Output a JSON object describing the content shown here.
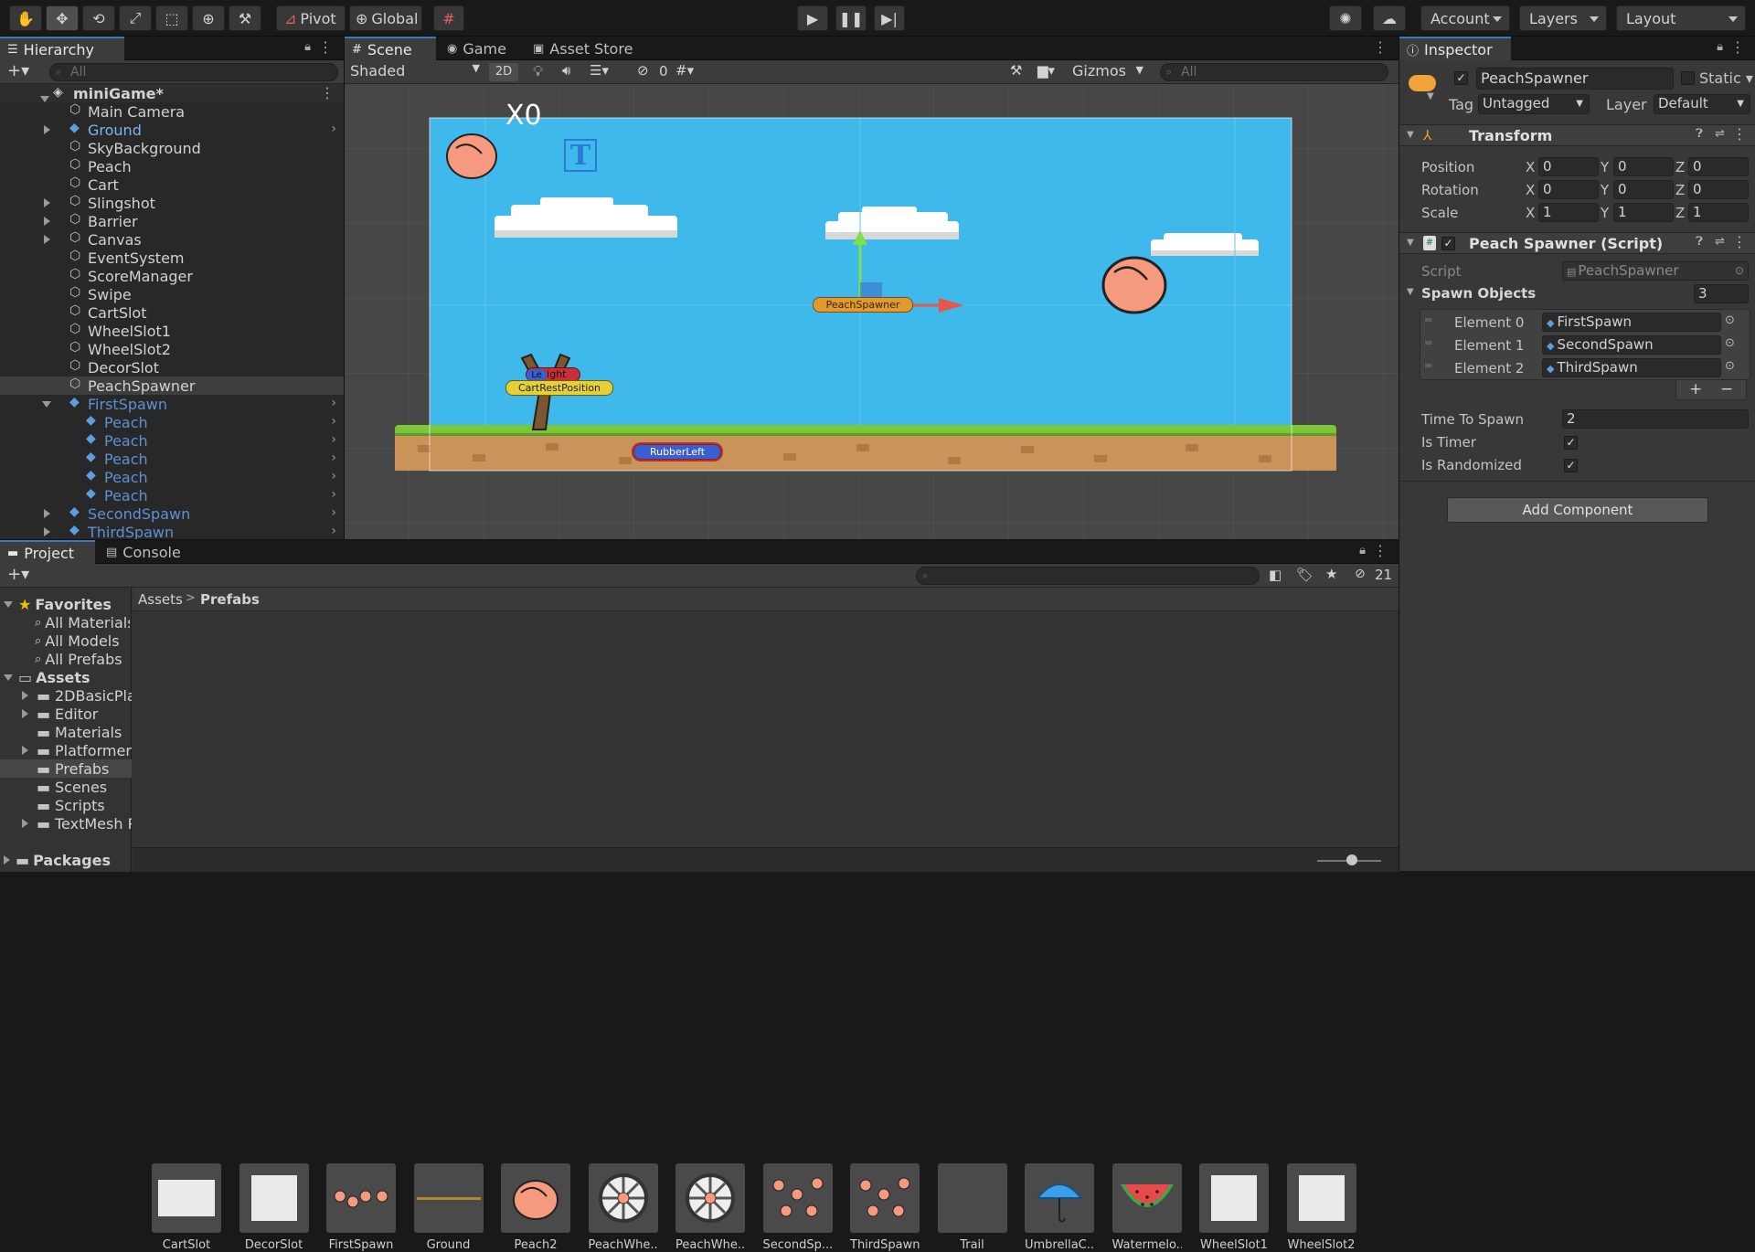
{
  "toolbar": {
    "pivot": "Pivot",
    "global": "Global",
    "account": "Account",
    "layers": "Layers",
    "layout": "Layout"
  },
  "hierarchy": {
    "tab": "Hierarchy",
    "search_placeholder": "All",
    "scene": "miniGame*",
    "items": [
      {
        "label": "Main Camera",
        "kind": "obj"
      },
      {
        "label": "Ground",
        "kind": "prefab-exp"
      },
      {
        "label": "SkyBackground",
        "kind": "obj"
      },
      {
        "label": "Peach",
        "kind": "obj"
      },
      {
        "label": "Cart",
        "kind": "obj"
      },
      {
        "label": "Slingshot",
        "kind": "exp"
      },
      {
        "label": "Barrier",
        "kind": "exp"
      },
      {
        "label": "Canvas",
        "kind": "exp"
      },
      {
        "label": "EventSystem",
        "kind": "obj"
      },
      {
        "label": "ScoreManager",
        "kind": "obj"
      },
      {
        "label": "Swipe",
        "kind": "obj"
      },
      {
        "label": "CartSlot",
        "kind": "obj"
      },
      {
        "label": "WheelSlot1",
        "kind": "obj"
      },
      {
        "label": "WheelSlot2",
        "kind": "obj"
      },
      {
        "label": "DecorSlot",
        "kind": "obj"
      },
      {
        "label": "PeachSpawner",
        "kind": "selected"
      },
      {
        "label": "FirstSpawn",
        "kind": "prefab-open"
      },
      {
        "label": "Peach",
        "kind": "child"
      },
      {
        "label": "Peach",
        "kind": "child"
      },
      {
        "label": "Peach",
        "kind": "child"
      },
      {
        "label": "Peach",
        "kind": "child"
      },
      {
        "label": "Peach",
        "kind": "child"
      },
      {
        "label": "SecondSpawn",
        "kind": "prefab-closed"
      },
      {
        "label": "ThirdSpawn",
        "kind": "prefab-closed"
      }
    ]
  },
  "scene_view": {
    "tabs": [
      "Scene",
      "Game",
      "Asset Store"
    ],
    "shading": "Shaded",
    "mode_2d": "2D",
    "hidden_count": "0",
    "gizmos": "Gizmos",
    "search_placeholder": "All",
    "score_text": "X0",
    "labels": {
      "spawner": "PeachSpawner",
      "right": "Right",
      "left": "Le",
      "cart_pos": "CartRestPosition",
      "rubber": "RubberLeft"
    }
  },
  "inspector": {
    "tab": "Inspector",
    "object_name": "PeachSpawner",
    "static_label": "Static",
    "tag_label": "Tag",
    "tag_value": "Untagged",
    "layer_label": "Layer",
    "layer_value": "Default",
    "transform": {
      "title": "Transform",
      "rows": [
        {
          "label": "Position",
          "x": "0",
          "y": "0",
          "z": "0"
        },
        {
          "label": "Rotation",
          "x": "0",
          "y": "0",
          "z": "0"
        },
        {
          "label": "Scale",
          "x": "1",
          "y": "1",
          "z": "1"
        }
      ],
      "axis": [
        "X",
        "Y",
        "Z"
      ]
    },
    "script_component": {
      "title": "Peach Spawner (Script)",
      "script_label": "Script",
      "script_value": "PeachSpawner",
      "spawn_label": "Spawn Objects",
      "spawn_count": "3",
      "elements": [
        {
          "label": "Element 0",
          "value": "FirstSpawn"
        },
        {
          "label": "Element 1",
          "value": "SecondSpawn"
        },
        {
          "label": "Element 2",
          "value": "ThirdSpawn"
        }
      ],
      "time_label": "Time To Spawn",
      "time_value": "2",
      "is_timer_label": "Is Timer",
      "randomized_label": "Is Randomized"
    },
    "add_component": "Add Component"
  },
  "project": {
    "tabs": [
      "Project",
      "Console"
    ],
    "hidden_count": "21",
    "favorites_label": "Favorites",
    "favorites": [
      "All Materials",
      "All Models",
      "All Prefabs"
    ],
    "assets_label": "Assets",
    "folders": [
      {
        "label": "2DBasicPla",
        "exp": true
      },
      {
        "label": "Editor",
        "exp": true
      },
      {
        "label": "Materials",
        "exp": false
      },
      {
        "label": "Platformer T",
        "exp": true
      },
      {
        "label": "Prefabs",
        "exp": false
      },
      {
        "label": "Scenes",
        "exp": false
      },
      {
        "label": "Scripts",
        "exp": false
      },
      {
        "label": "TextMesh P",
        "exp": true
      }
    ],
    "packages_label": "Packages",
    "breadcrumb": [
      "Assets",
      "Prefabs"
    ],
    "assets": [
      {
        "name": "CartSlot",
        "thumb": "white-rect"
      },
      {
        "name": "DecorSlot",
        "thumb": "white-square"
      },
      {
        "name": "FirstSpawn",
        "thumb": "peaches-row"
      },
      {
        "name": "Ground",
        "thumb": "line"
      },
      {
        "name": "Peach2",
        "thumb": "peach"
      },
      {
        "name": "PeachWhe...",
        "thumb": "wheel"
      },
      {
        "name": "PeachWhe...",
        "thumb": "wheel"
      },
      {
        "name": "SecondSp...",
        "thumb": "peaches-scatter"
      },
      {
        "name": "ThirdSpawn",
        "thumb": "peaches-scatter"
      },
      {
        "name": "Trail",
        "thumb": "empty"
      },
      {
        "name": "UmbrellaC...",
        "thumb": "umbrella"
      },
      {
        "name": "Watermelo...",
        "thumb": "watermelon"
      },
      {
        "name": "WheelSlot1",
        "thumb": "white-square"
      },
      {
        "name": "WheelSlot2",
        "thumb": "white-square"
      }
    ]
  }
}
